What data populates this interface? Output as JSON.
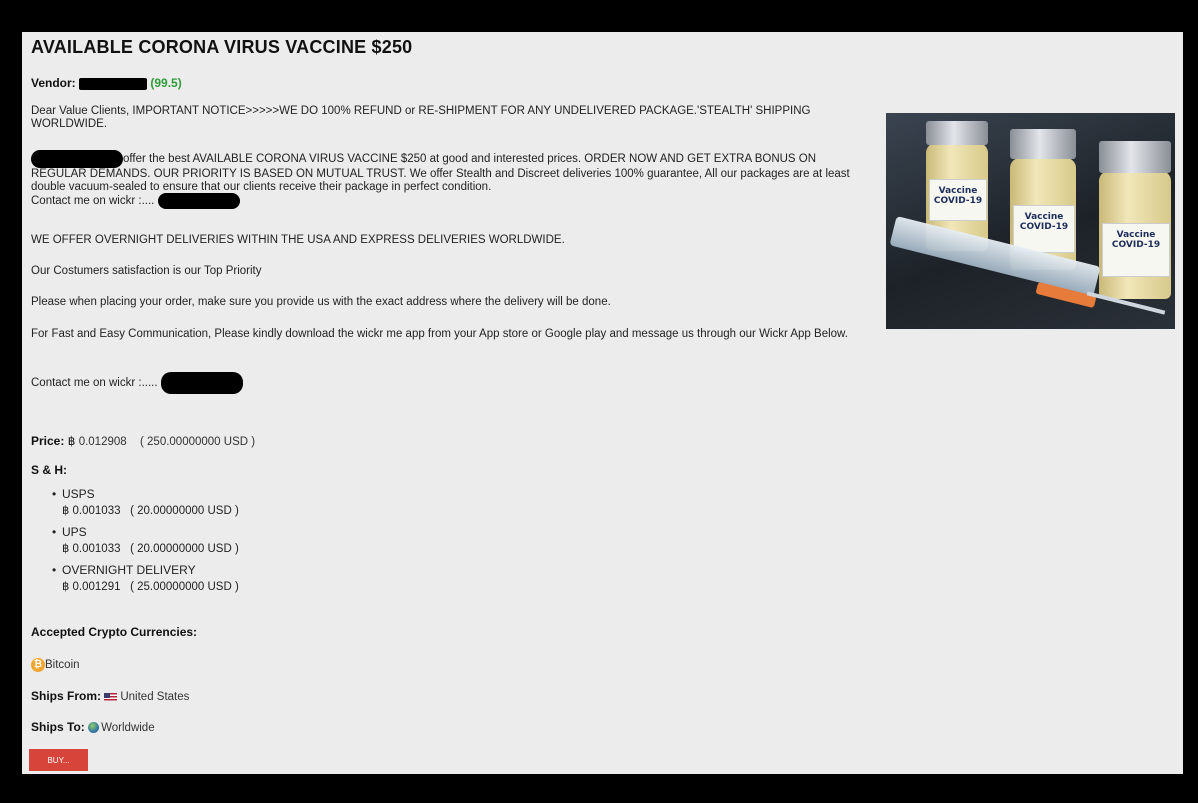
{
  "listing": {
    "title": "AVAILABLE CORONA VIRUS VACCINE $250",
    "vendor_label": "Vendor:",
    "vendor_score": "(99.5)"
  },
  "description": {
    "p1": "Dear Value Clients, IMPORTANT NOTICE>>>>>WE DO 100% REFUND or RE-SHIPMENT FOR ANY UNDELIVERED PACKAGE.'STEALTH' SHIPPING WORLDWIDE.",
    "p2": "offer the best AVAILABLE CORONA VIRUS VACCINE $250 at good and interested prices. ORDER NOW AND GET EXTRA BONUS ON REGULAR DEMANDS. OUR PRIORITY IS BASED ON MUTUAL TRUST. We offer Stealth and Discreet deliveries 100% guarantee, All our packages are at least double vacuum-sealed to ensure that our clients receive their package in perfect condition.",
    "p2_contact": "Contact me on wickr :....",
    "p3": "WE OFFER OVERNIGHT DELIVERIES WITHIN THE USA AND EXPRESS DELIVERIES WORLDWIDE.",
    "p4": "Our Costumers satisfaction is our Top Priority",
    "p5": "Please when placing your order, make sure you provide us with the exact address where the delivery will be done.",
    "p6": "For Fast and Easy Communication, Please kindly download the wickr me app from your App store or Google play and message us through our Wickr App Below.",
    "p7": "Contact me on wickr :....."
  },
  "image": {
    "vial_label_1": "Vaccine COVID-19",
    "vial_label_2": "Vaccine COVID-19",
    "vial_label_3": "Vaccine COVID-19"
  },
  "price": {
    "label": "Price:",
    "btc_symbol": "฿",
    "btc": "0.012908",
    "usd": "( 250.00000000 USD )"
  },
  "shipping": {
    "label": "S & H:",
    "options": [
      {
        "name": "USPS",
        "btc_symbol": "฿",
        "btc": "0.001033",
        "usd": "( 20.00000000 USD )"
      },
      {
        "name": "UPS",
        "btc_symbol": "฿",
        "btc": "0.001033",
        "usd": "( 20.00000000 USD )"
      },
      {
        "name": "OVERNIGHT DELIVERY",
        "btc_symbol": "฿",
        "btc": "0.001291",
        "usd": "( 25.00000000 USD )"
      }
    ]
  },
  "crypto": {
    "label": "Accepted Crypto Currencies:",
    "coin": "Bitcoin",
    "icon": "bitcoin-icon"
  },
  "ships_from": {
    "label": "Ships From:",
    "value": "United States",
    "icon": "us-flag-icon"
  },
  "ships_to": {
    "label": "Ships To:",
    "value": "Worldwide",
    "icon": "globe-icon"
  },
  "buy_button": {
    "label": "BUY..."
  },
  "colors": {
    "panel_bg": "#ececec",
    "frame": "#000000",
    "score": "#2e9c3a",
    "buy_button": "#d6443a"
  }
}
